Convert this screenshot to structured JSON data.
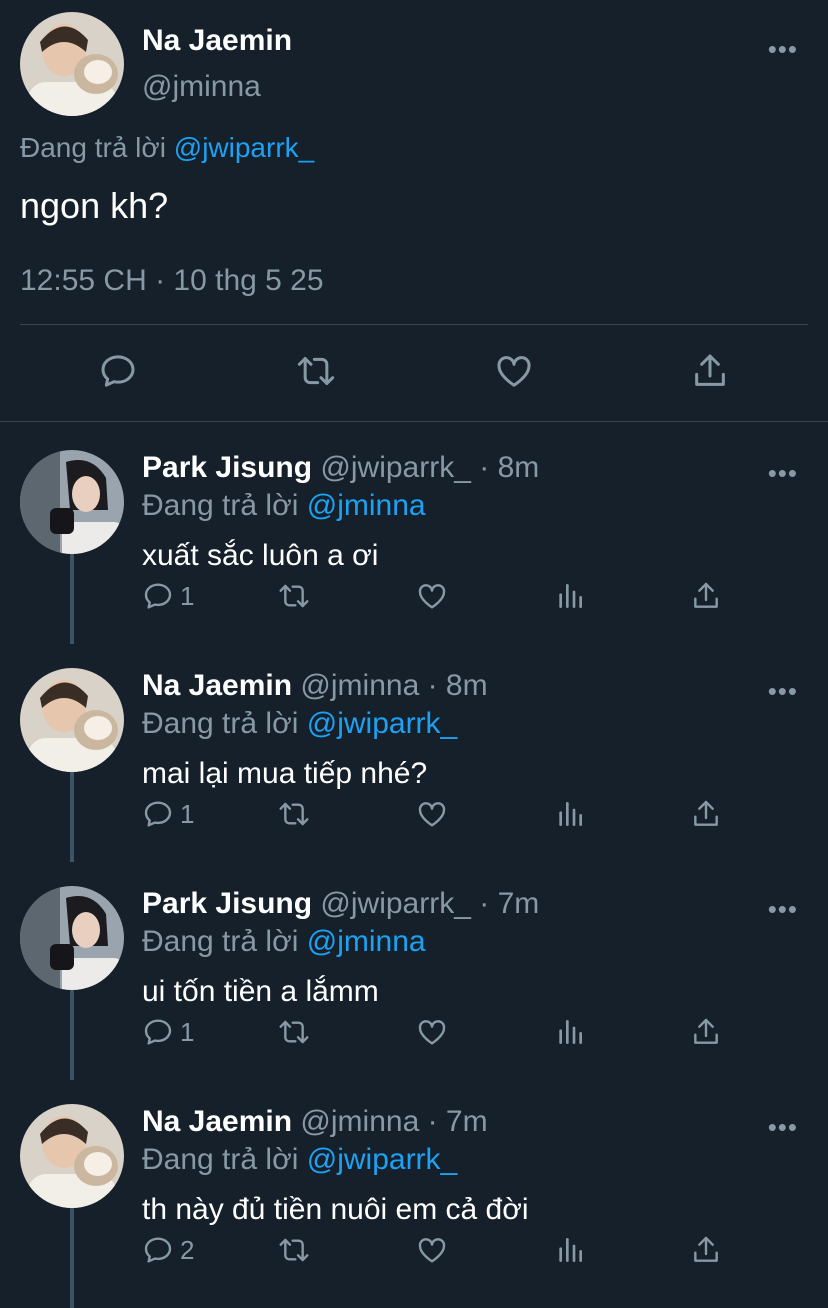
{
  "main_tweet": {
    "name": "Na Jaemin",
    "handle": "@jminna",
    "reply_prefix": "Đang trả lời",
    "reply_to": "@jwiparrk_",
    "text": "ngon kh?",
    "timestamp": "12:55 CH · 10 thg 5 25",
    "actions": [
      "reply-icon",
      "retweet-icon",
      "like-icon",
      "share-icon"
    ]
  },
  "replies": [
    {
      "name": "Park Jisung",
      "meta": "@jwiparrk_ · 8m",
      "reply_prefix": "Đang trả lời",
      "reply_to": "@jminna",
      "text": "xuất sắc luôn a ơi",
      "reply_count": "1"
    },
    {
      "name": "Na Jaemin",
      "meta": "@jminna · 8m",
      "reply_prefix": "Đang trả lời",
      "reply_to": "@jwiparrk_",
      "text": "mai lại mua tiếp nhé?",
      "reply_count": "1"
    },
    {
      "name": "Park Jisung",
      "meta": "@jwiparrk_ · 7m",
      "reply_prefix": "Đang trả lời",
      "reply_to": "@jminna",
      "text": "ui tốn tiền a lắmm",
      "reply_count": "1"
    },
    {
      "name": "Na Jaemin",
      "meta": "@jminna · 7m",
      "reply_prefix": "Đang trả lời",
      "reply_to": "@jwiparrk_",
      "text": "th này đủ tiền nuôi em cả đời",
      "reply_count": "2"
    }
  ],
  "colors": {
    "background": "#15202b",
    "secondary_text": "#8899a6",
    "mention": "#1da1f2",
    "divider": "#38444d"
  }
}
